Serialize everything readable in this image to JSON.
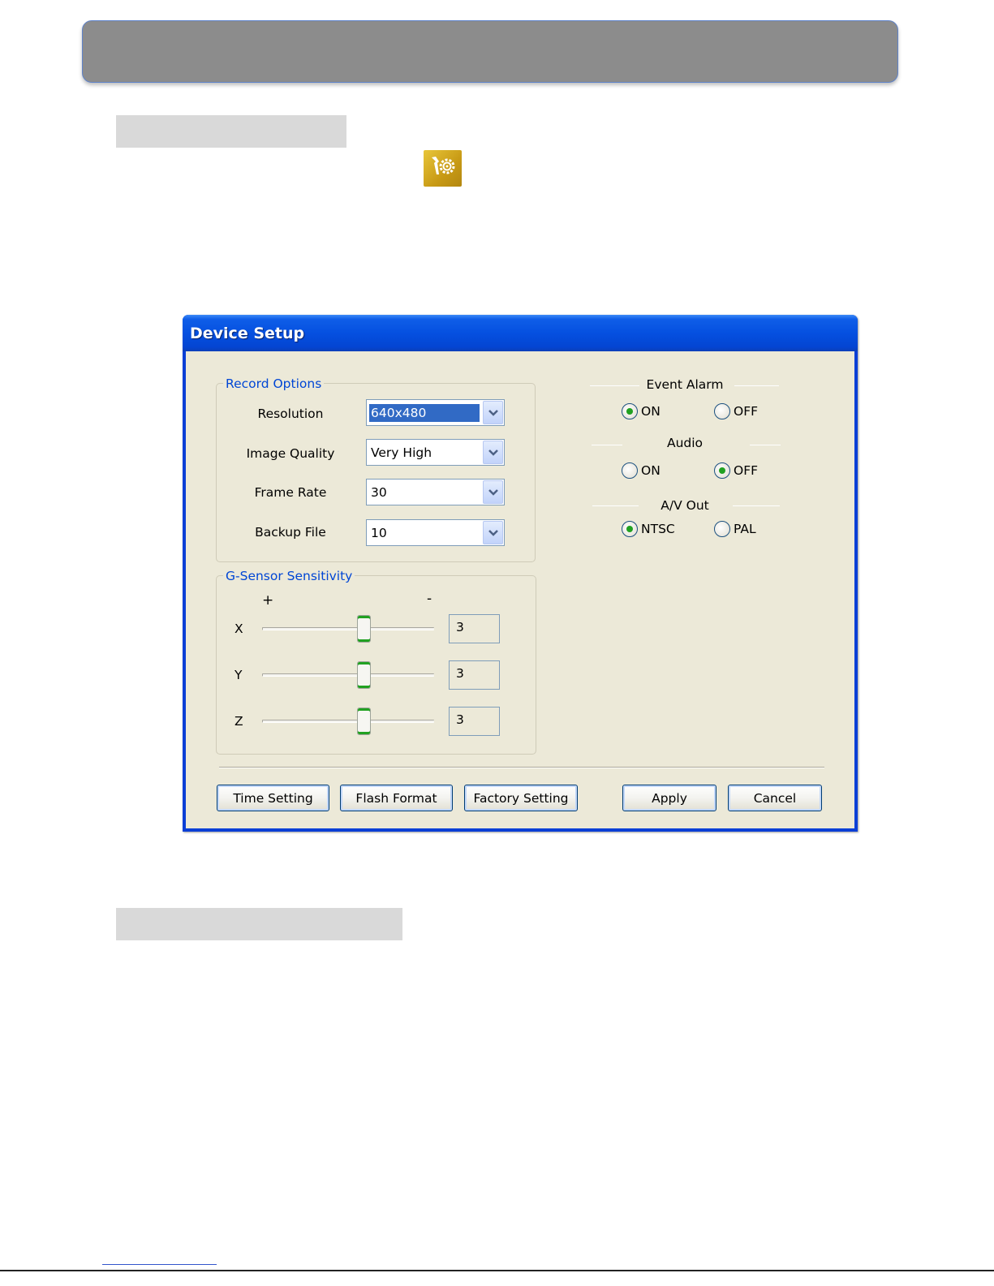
{
  "dialog": {
    "title": "Device Setup",
    "record_options": {
      "legend": "Record Options",
      "fields": [
        {
          "label": "Resolution",
          "value": "640x480"
        },
        {
          "label": "Image Quality",
          "value": "Very High"
        },
        {
          "label": "Frame Rate",
          "value": "30"
        },
        {
          "label": "Backup File",
          "value": "10"
        }
      ]
    },
    "gsensor": {
      "legend": "G-Sensor Sensitivity",
      "plus": "+",
      "minus": "-",
      "axes": [
        {
          "label": "X",
          "value": "3"
        },
        {
          "label": "Y",
          "value": "3"
        },
        {
          "label": "Z",
          "value": "3"
        }
      ]
    },
    "event_alarm": {
      "title": "Event Alarm",
      "options": [
        "ON",
        "OFF"
      ],
      "selected": "ON"
    },
    "audio": {
      "title": "Audio",
      "options": [
        "ON",
        "OFF"
      ],
      "selected": "OFF"
    },
    "av_out": {
      "title": "A/V Out",
      "options": [
        "NTSC",
        "PAL"
      ],
      "selected": "NTSC"
    },
    "buttons": {
      "time_setting": "Time Setting",
      "flash_format": "Flash Format",
      "factory_setting": "Factory Setting",
      "apply": "Apply",
      "cancel": "Cancel"
    }
  },
  "colors": {
    "titlebar": "#0550e0",
    "dialog_bg": "#ece9d8",
    "group_legend": "#0046d5",
    "selection": "#316ac5",
    "radio_dot": "#21a121",
    "settings_icon_bg": "#c89a15"
  },
  "icons": {
    "toolbar": "settings-tools-icon",
    "dropdown": "chevron-down-icon"
  }
}
